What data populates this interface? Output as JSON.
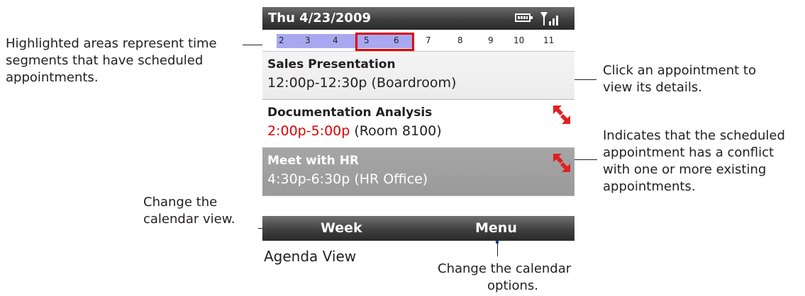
{
  "phone": {
    "date": "Thu 4/23/2009",
    "battery_icon": "battery-icon",
    "signal_icon": "signal-icon",
    "hours": [
      "2",
      "3",
      "4",
      "5",
      "6",
      "7",
      "8",
      "9",
      "10",
      "11"
    ],
    "appointments": [
      {
        "title": "Sales Presentation",
        "when": "12:00p-12:30p",
        "where": "(Boardroom)",
        "conflict": false
      },
      {
        "title": "Documentation Analysis",
        "when": "2:00p-5:00p",
        "where": "(Room 8100)",
        "conflict": true
      },
      {
        "title": "Meet with HR",
        "when": "4:30p-6:30p",
        "where": "(HR Office)",
        "conflict": true,
        "selected": true
      }
    ],
    "softkeys": {
      "left": "Week",
      "right": "Menu"
    },
    "colors": {
      "highlight": "#a8a8f0",
      "selection": "#e00000",
      "conflict_time": "#e00000"
    }
  },
  "callouts": {
    "highlighted": [
      "Highlighted areas represent time",
      "segments that have scheduled",
      "appointments."
    ],
    "click": [
      "Click an appointment to",
      "view its details."
    ],
    "conflict": [
      "Indicates that the scheduled",
      "appointment has a conflict",
      "with one or more existing",
      "appointments."
    ],
    "change_view": [
      "Change the",
      "calendar view."
    ],
    "options": [
      "Change the calendar",
      "options."
    ]
  },
  "caption": "Agenda View"
}
